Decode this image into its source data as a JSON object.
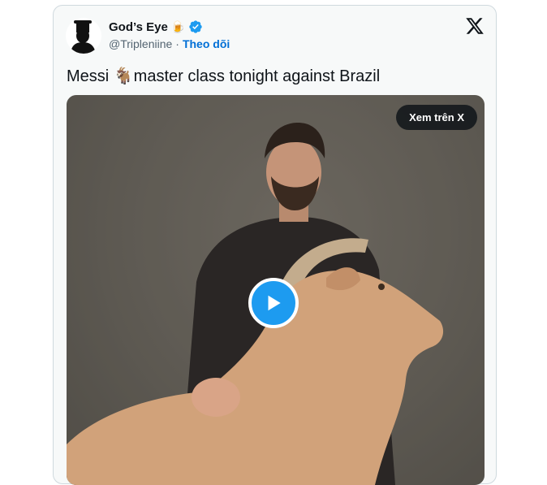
{
  "tweet": {
    "display_name": "God’s Eye",
    "name_emoji": "🍺",
    "handle": "@Tripleniine",
    "separator": "·",
    "follow_label": "Theo dõi",
    "text": "Messi 🐐master class tonight against Brazil"
  },
  "media": {
    "view_on_x_label": "Xem trên X",
    "icons": {
      "play": "play-icon",
      "brand": "x-logo-icon",
      "verified": "verified-badge-icon"
    }
  },
  "colors": {
    "follow_link": "#006fd6",
    "verified_badge": "#1d9bf0",
    "play_button": "#1d9bf0",
    "card_background": "#f7f9f9"
  }
}
